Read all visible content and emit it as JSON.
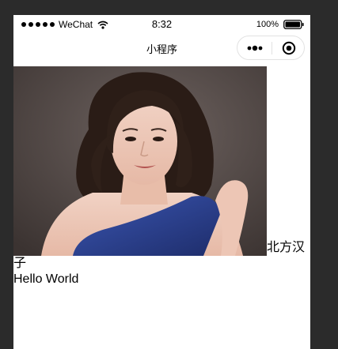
{
  "status_bar": {
    "carrier": "WeChat",
    "time": "8:32",
    "battery_percent": "100%"
  },
  "nav_bar": {
    "title": "小程序"
  },
  "content": {
    "photo_caption": "北方汉子",
    "greeting": "Hello World"
  },
  "colors": {
    "frame_background": "#2b2b2b",
    "page_background": "#ffffff",
    "photo_backdrop": "#4a4140",
    "dress_blue": "#2b3f8c"
  },
  "icons": {
    "signal": "signal-dots-icon",
    "wifi": "wifi-icon",
    "battery": "battery-icon",
    "menu": "more-dots-icon",
    "close": "target-close-icon"
  }
}
